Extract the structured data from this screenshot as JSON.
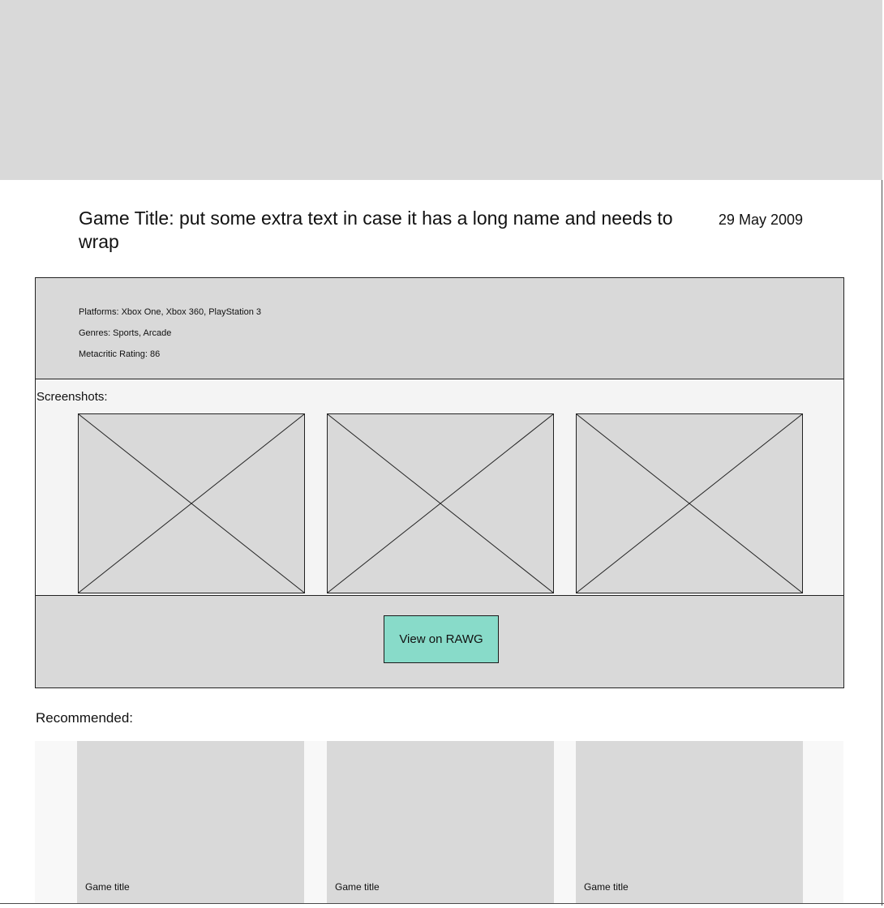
{
  "game": {
    "title": "Game Title: put some extra text in case it has a long name and needs to wrap",
    "release_date": "29 May 2009"
  },
  "details": {
    "platforms": "Platforms: Xbox One, Xbox 360, PlayStation 3",
    "genres": "Genres: Sports, Arcade",
    "metacritic": "Metacritic Rating: 86"
  },
  "screenshots": {
    "label": "Screenshots:",
    "count": 3
  },
  "actions": {
    "view_on_rawg": "View on RAWG"
  },
  "recommended": {
    "label": "Recommended:",
    "items": [
      {
        "title": "Game title"
      },
      {
        "title": "Game title"
      },
      {
        "title": "Game title"
      }
    ]
  },
  "colors": {
    "placeholder": "#d9d9d9",
    "button_accent": "#88dbc9",
    "strip_background": "#f4f4f4",
    "border": "#222222"
  }
}
